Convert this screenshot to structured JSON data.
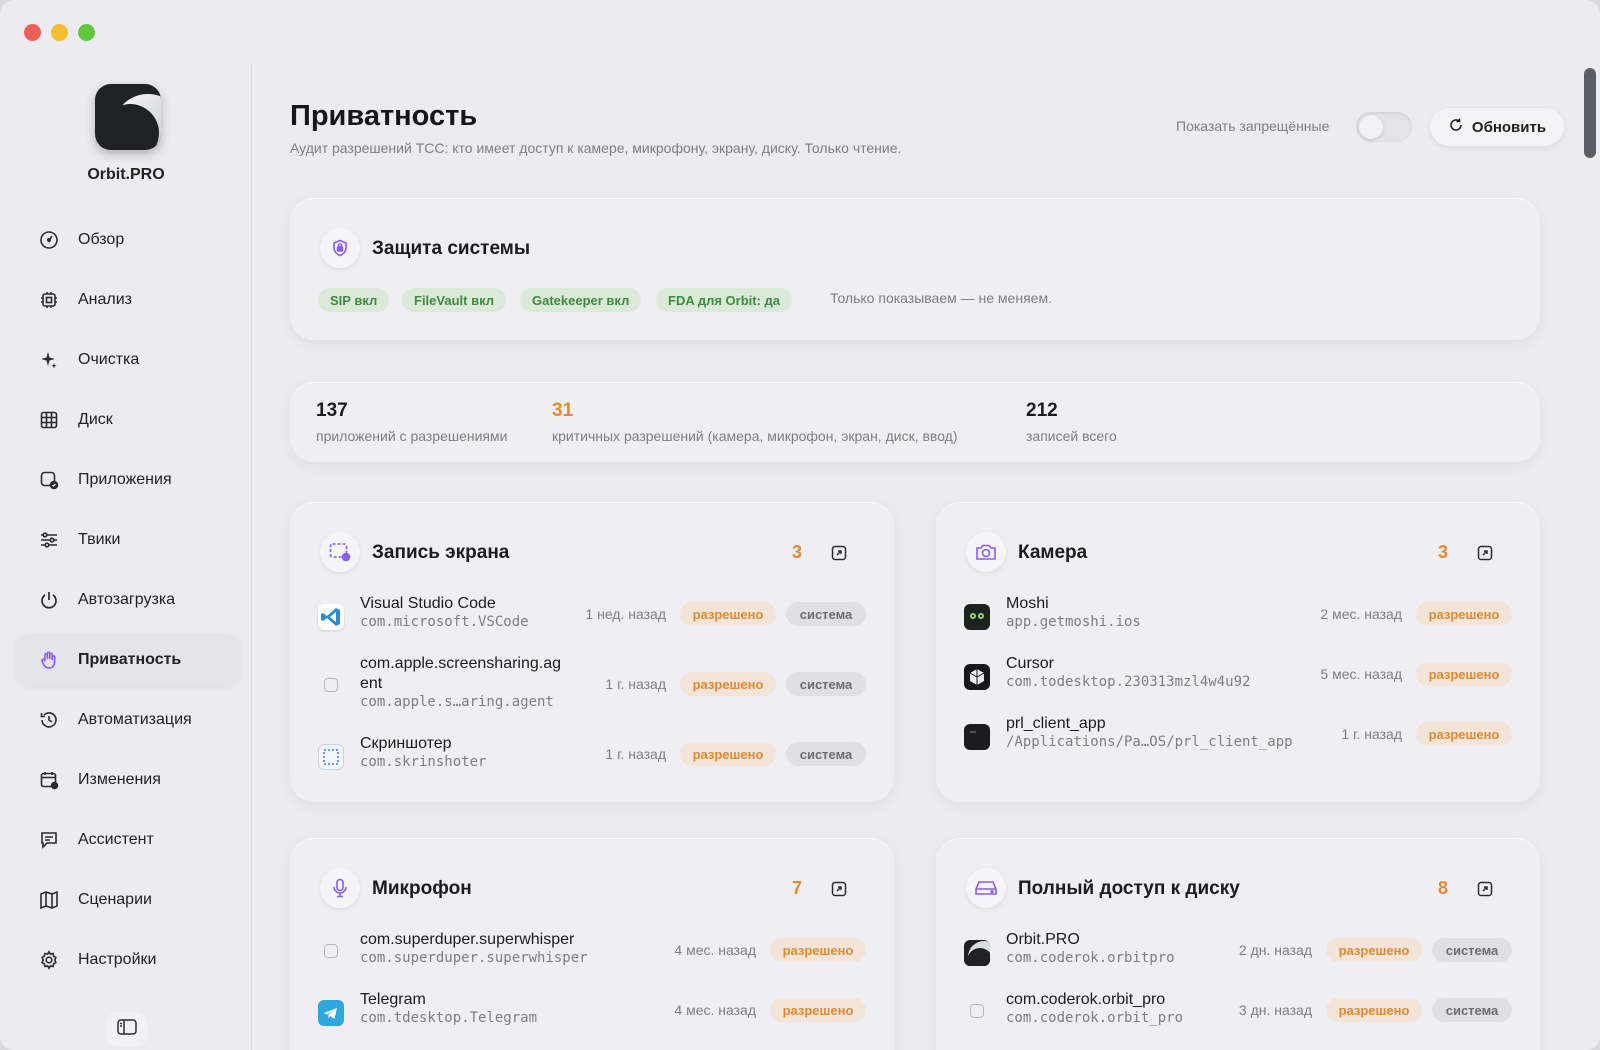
{
  "app": {
    "name": "Orbit.PRO"
  },
  "sidebar": {
    "items": [
      {
        "label": "Обзор",
        "icon": "gauge-icon"
      },
      {
        "label": "Анализ",
        "icon": "chip-icon"
      },
      {
        "label": "Очистка",
        "icon": "sparkles-icon"
      },
      {
        "label": "Диск",
        "icon": "grid-icon"
      },
      {
        "label": "Приложения",
        "icon": "app-check-icon"
      },
      {
        "label": "Твики",
        "icon": "sliders-icon"
      },
      {
        "label": "Автозагрузка",
        "icon": "power-icon"
      },
      {
        "label": "Приватность",
        "icon": "hand-icon",
        "active": true
      },
      {
        "label": "Автоматизация",
        "icon": "history-icon"
      },
      {
        "label": "Изменения",
        "icon": "calendar-icon"
      },
      {
        "label": "Ассистент",
        "icon": "chat-icon"
      },
      {
        "label": "Сценарии",
        "icon": "map-icon"
      },
      {
        "label": "Настройки",
        "icon": "gear-icon"
      }
    ]
  },
  "header": {
    "title": "Приватность",
    "subtitle": "Аудит разрешений TCC: кто имеет доступ к камере, микрофону, экрану, диску. Только чтение.",
    "show_denied_label": "Показать запрещённые",
    "show_denied": false,
    "refresh_label": "Обновить"
  },
  "protection": {
    "title": "Защита системы",
    "chips": [
      "SIP вкл",
      "FileVault вкл",
      "Gatekeeper вкл",
      "FDA для Orbit: да"
    ],
    "note": "Только показываем — не меняем."
  },
  "stats": [
    {
      "value": "137",
      "label": "приложений с разрешениями"
    },
    {
      "value": "31",
      "label": "критичных разрешений (камера, микрофон, экран, диск, ввод)"
    },
    {
      "value": "212",
      "label": "записей всего"
    }
  ],
  "colors": {
    "accent": "#e08a33",
    "chip_green": "#3f8a41",
    "purple": "#8a5cf0"
  },
  "sections": {
    "screen": {
      "title": "Запись экрана",
      "count": "3",
      "rows": [
        {
          "name": "Visual Studio Code",
          "bundle": "com.microsoft.VSCode",
          "time": "1 нед. назад",
          "status": "разрешено",
          "system": "система"
        },
        {
          "name": "com.apple.screensharing.ag",
          "name2": "ent",
          "bundle": "com.apple.s…aring.agent",
          "time": "1 г. назад",
          "status": "разрешено",
          "system": "система"
        },
        {
          "name": "Скриншотер",
          "bundle": "com.skrinshoter",
          "time": "1 г. назад",
          "status": "разрешено",
          "system": "система"
        }
      ]
    },
    "camera": {
      "title": "Камера",
      "count": "3",
      "rows": [
        {
          "name": "Moshi",
          "bundle": "app.getmoshi.ios",
          "time": "2 мес. назад",
          "status": "разрешено"
        },
        {
          "name": "Cursor",
          "bundle": "com.todesktop.230313mzl4w4u92",
          "time": "5 мес. назад",
          "status": "разрешено"
        },
        {
          "name": "prl_client_app",
          "bundle": "/Applications/Pa…OS/prl_client_app",
          "time": "1 г. назад",
          "status": "разрешено"
        }
      ]
    },
    "mic": {
      "title": "Микрофон",
      "count": "7",
      "rows": [
        {
          "name": "com.superduper.superwhisper",
          "bundle": "com.superduper.superwhisper",
          "time": "4 мес. назад",
          "status": "разрешено"
        },
        {
          "name": "Telegram",
          "bundle": "com.tdesktop.Telegram",
          "time": "4 мес. назад",
          "status": "разрешено"
        }
      ]
    },
    "disk": {
      "title": "Полный доступ к диску",
      "count": "8",
      "rows": [
        {
          "name": "Orbit.PRO",
          "bundle": "com.coderok.orbitpro",
          "time": "2 дн. назад",
          "status": "разрешено",
          "system": "система"
        },
        {
          "name": "com.coderok.orbit_pro",
          "bundle": "com.coderok.orbit_pro",
          "time": "3 дн. назад",
          "status": "разрешено",
          "system": "система"
        }
      ]
    }
  }
}
